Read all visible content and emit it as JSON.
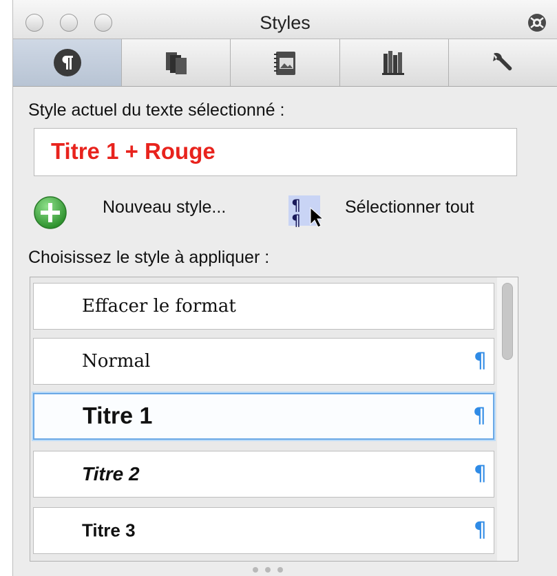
{
  "window": {
    "title": "Styles"
  },
  "tabs": [
    {
      "id": "paragraph-styles",
      "icon": "pilcrow-icon",
      "active": true
    },
    {
      "id": "books",
      "icon": "books-icon",
      "active": false
    },
    {
      "id": "media",
      "icon": "media-icon",
      "active": false
    },
    {
      "id": "library",
      "icon": "library-icon",
      "active": false
    },
    {
      "id": "tools",
      "icon": "wrench-icon",
      "active": false
    }
  ],
  "current": {
    "label": "Style actuel du texte sélectionné :",
    "value": "Titre 1 + Rouge",
    "value_color": "#e8231d"
  },
  "actions": {
    "new_style": "Nouveau style...",
    "select_all": "Sélectionner tout"
  },
  "list": {
    "label": "Choisissez le style à appliquer :",
    "items": [
      {
        "name": "Effacer le format",
        "paragraph_mark": ""
      },
      {
        "name": "Normal",
        "paragraph_mark": "¶"
      },
      {
        "name": "Titre 1",
        "paragraph_mark": "¶"
      },
      {
        "name": "Titre 2",
        "paragraph_mark": "¶"
      },
      {
        "name": "Titre 3",
        "paragraph_mark": "¶"
      }
    ],
    "selected": "Titre 1"
  },
  "colors": {
    "accent": "#2f8be6",
    "selection": "#6aa8e6",
    "add_green": "#3aa33a"
  }
}
